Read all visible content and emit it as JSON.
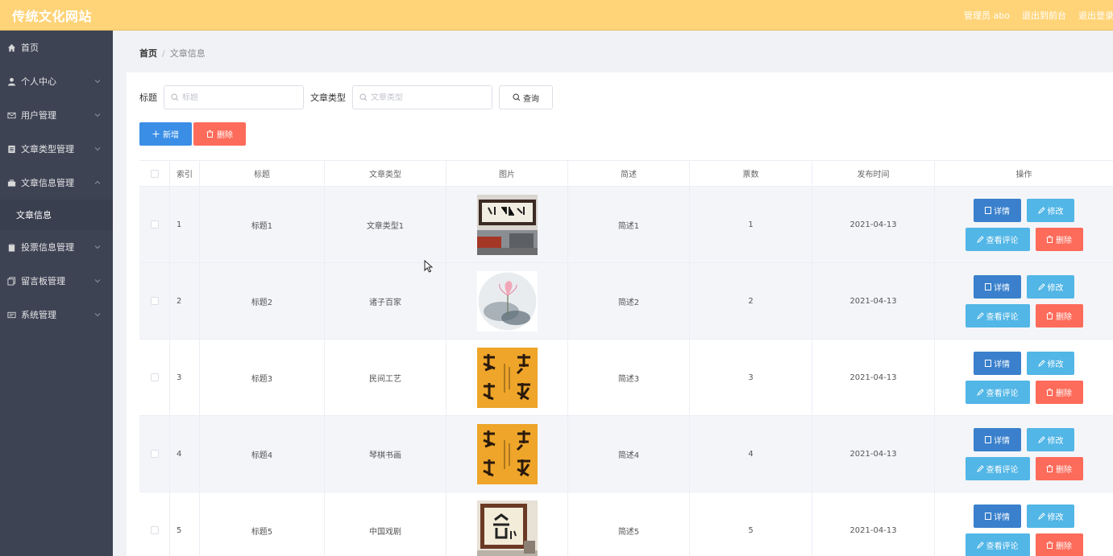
{
  "header": {
    "brand": "传统文化网站",
    "admin": "管理员 abo",
    "back_front": "退出到前台",
    "logout": "退出登录"
  },
  "sidebar": {
    "items": [
      {
        "label": "首页",
        "icon": "home-icon"
      },
      {
        "label": "个人中心",
        "icon": "user-icon"
      },
      {
        "label": "用户管理",
        "icon": "mail-icon"
      },
      {
        "label": "文章类型管理",
        "icon": "list-icon"
      },
      {
        "label": "文章信息管理",
        "icon": "briefcase-icon"
      },
      {
        "label": "投票信息管理",
        "icon": "clipboard-icon"
      },
      {
        "label": "留言板管理",
        "icon": "copy-icon"
      },
      {
        "label": "系统管理",
        "icon": "message-icon"
      }
    ],
    "subitem": "文章信息"
  },
  "breadcrumb": {
    "home": "首页",
    "current": "文章信息"
  },
  "search": {
    "title_label": "标题",
    "title_placeholder": "标题",
    "type_label": "文章类型",
    "type_placeholder": "文章类型",
    "query_button": "查询"
  },
  "actions": {
    "add": "新增",
    "delete": "删除"
  },
  "table": {
    "headers": [
      "索引",
      "标题",
      "文章类型",
      "图片",
      "简述",
      "票数",
      "发布时间",
      "操作"
    ],
    "rows": [
      {
        "index": "1",
        "title": "标题1",
        "type": "文章类型1",
        "desc": "简述1",
        "votes": "1",
        "time": "2021-04-13"
      },
      {
        "index": "2",
        "title": "标题2",
        "type": "诸子百家",
        "desc": "简述2",
        "votes": "2",
        "time": "2021-04-13"
      },
      {
        "index": "3",
        "title": "标题3",
        "type": "民间工艺",
        "desc": "简述3",
        "votes": "3",
        "time": "2021-04-13"
      },
      {
        "index": "4",
        "title": "标题4",
        "type": "琴棋书画",
        "desc": "简述4",
        "votes": "4",
        "time": "2021-04-13"
      },
      {
        "index": "5",
        "title": "标题5",
        "type": "中国戏剧",
        "desc": "简述5",
        "votes": "5",
        "time": "2021-04-13"
      }
    ],
    "ops": {
      "detail": "详情",
      "edit": "修改",
      "comment": "查看评论",
      "delete": "删除"
    }
  },
  "colors": {
    "header": "#ffd479",
    "sidebar": "#3e4354",
    "primary": "#3a8ee6",
    "danger": "#fd6b5a",
    "info": "#52b6e6"
  }
}
